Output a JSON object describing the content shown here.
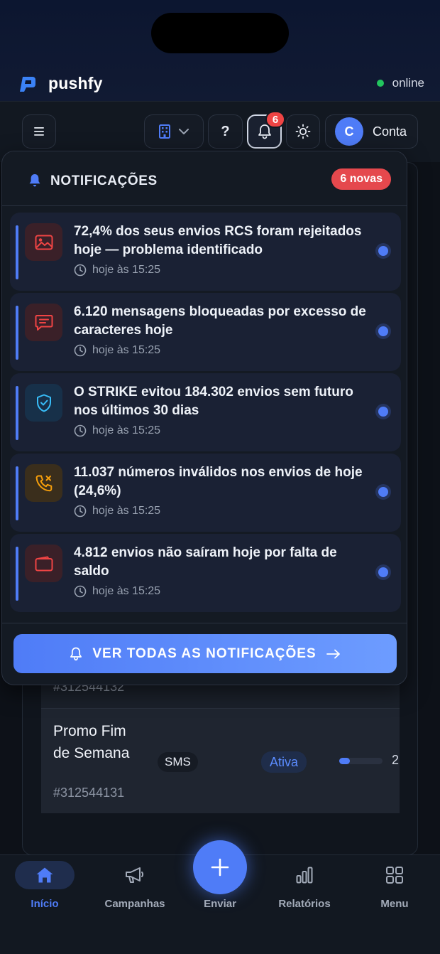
{
  "brand": {
    "name": "pushfy",
    "status": "online",
    "status_color": "#22c55e"
  },
  "toolbar": {
    "help_label": "?",
    "bell_badge": "6",
    "account_initial": "C",
    "account_label": "Conta"
  },
  "notifications": {
    "title": "NOTIFICAÇÕES",
    "badge": "6 novas",
    "items": [
      {
        "text": "72,4% dos seus envios RCS foram rejeitados hoje — problema identificado",
        "time": "hoje às 15:25",
        "icon": "image-icon",
        "accent": "#ef4444",
        "unread": true
      },
      {
        "text": "6.120 mensagens bloqueadas por excesso de caracteres hoje",
        "time": "hoje às 15:25",
        "icon": "message-icon",
        "accent": "#ef4444",
        "unread": true
      },
      {
        "text": "O STRIKE evitou 184.302 envios sem futuro nos últimos 30 dias",
        "time": "hoje às 15:25",
        "icon": "shield-check-icon",
        "accent": "#38bdf8",
        "unread": true
      },
      {
        "text": "11.037 números inválidos nos envios de hoje (24,6%)",
        "time": "hoje às 15:25",
        "icon": "phone-x-icon",
        "accent": "#f59e0b",
        "unread": true
      },
      {
        "text": "4.812 envios não saíram hoje por falta de saldo",
        "time": "hoje às 15:25",
        "icon": "wallet-icon",
        "accent": "#ef4444",
        "unread": true
      }
    ],
    "see_all_label": "VER TODAS AS NOTIFICAÇÕES"
  },
  "campaigns": {
    "rows": [
      {
        "code": "#312544132"
      },
      {
        "name": "Promo Fim de Semana",
        "code": "#312544131",
        "channel": "SMS",
        "status": "Ativa",
        "progress": 0.25,
        "count": "2"
      }
    ]
  },
  "bottom_nav": {
    "items": [
      {
        "label": "Início",
        "icon": "home-icon",
        "active": true
      },
      {
        "label": "Campanhas",
        "icon": "megaphone-icon",
        "active": false
      },
      {
        "label": "Enviar",
        "icon": "plus-icon",
        "active": false
      },
      {
        "label": "Relatórios",
        "icon": "bar-chart-icon",
        "active": false
      },
      {
        "label": "Menu",
        "icon": "grid-icon",
        "active": false
      }
    ]
  },
  "colors": {
    "accent": "#4f7cf7",
    "danger": "#ef4444",
    "background": "#0d1118"
  }
}
